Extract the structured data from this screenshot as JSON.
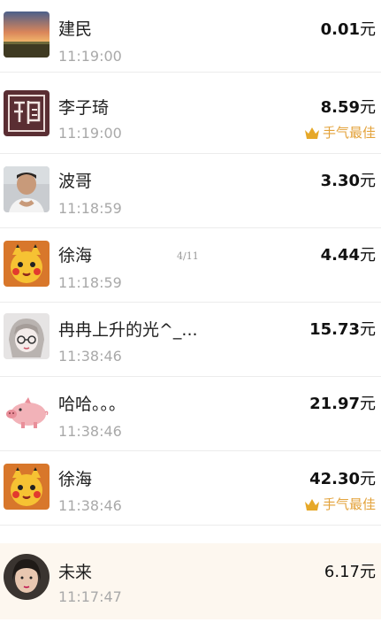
{
  "pager": "4/11",
  "currency_unit": "元",
  "best_label": "手气最佳",
  "colors": {
    "best": "#e3a23a",
    "time": "#a9a9a9",
    "mine_bg": "#fdf7ef"
  },
  "entries": [
    {
      "name": "建民",
      "time": "11:19:00",
      "amount": "0.01",
      "best": false,
      "avatar": "sunset-avatar"
    },
    {
      "name": "李子琦",
      "time": "11:19:00",
      "amount": "8.59",
      "best": true,
      "avatar": "calligraphy-avatar"
    },
    {
      "name": "波哥",
      "time": "11:18:59",
      "amount": "3.30",
      "best": false,
      "avatar": "man-avatar"
    },
    {
      "name": "徐海",
      "time": "11:18:59",
      "amount": "4.44",
      "best": false,
      "avatar": "pikachu-avatar"
    },
    {
      "name": "冉冉上升的光^_...",
      "time": "11:38:46",
      "amount": "15.73",
      "best": false,
      "avatar": "anime-girl-avatar"
    },
    {
      "name": "哈哈。。。",
      "time": "11:38:46",
      "amount": "21.97",
      "best": false,
      "avatar": "pig-avatar"
    },
    {
      "name": "徐海",
      "time": "11:38:46",
      "amount": "42.30",
      "best": true,
      "avatar": "pikachu-avatar"
    },
    {
      "name": "未来",
      "time": "11:17:47",
      "amount": "6.17",
      "best": false,
      "avatar": "woman-avatar"
    }
  ]
}
